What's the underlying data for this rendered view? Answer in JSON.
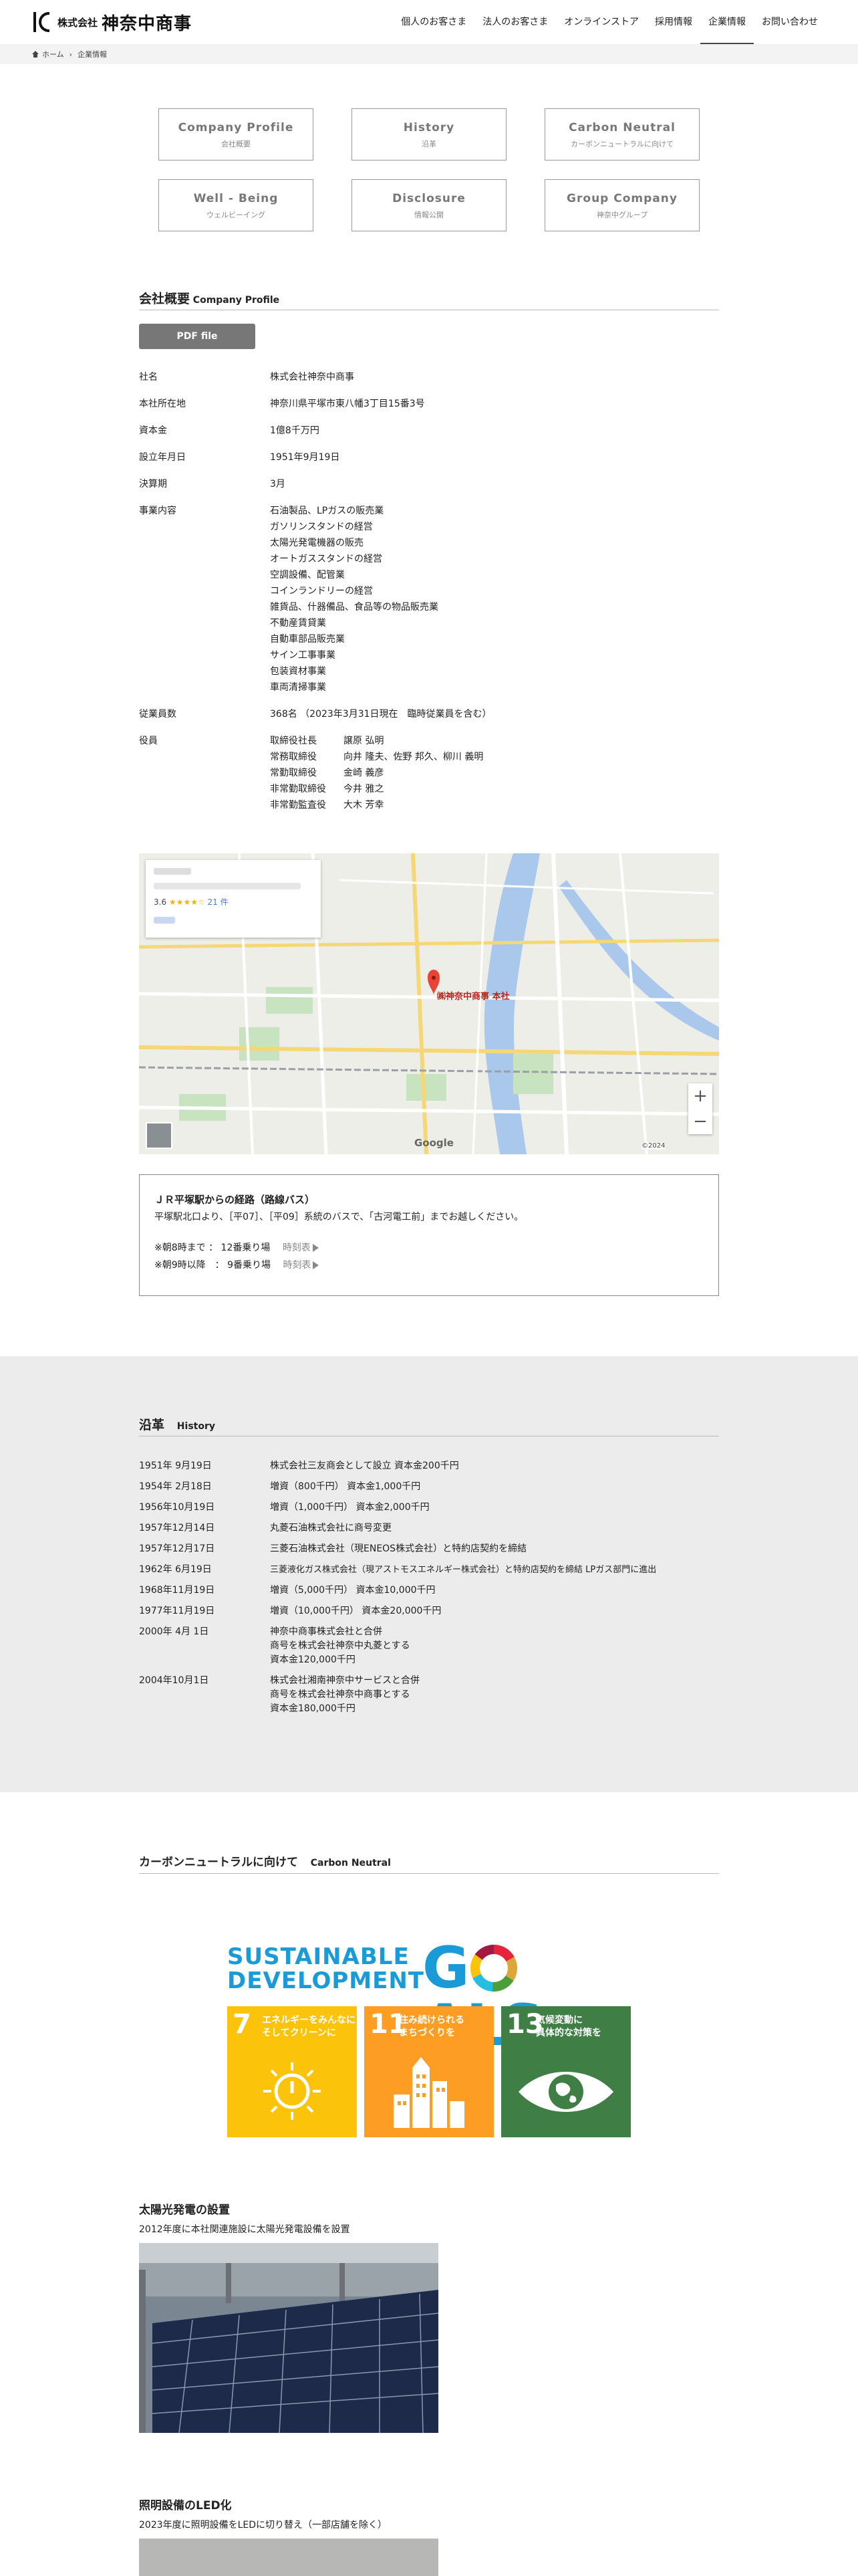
{
  "header": {
    "logo_small": "株式会社",
    "logo_big": "神奈中商事",
    "nav": [
      "個人のお客さま",
      "法人のお客さま",
      "オンラインストア",
      "採用情報",
      "企業情報",
      "お問い合わせ"
    ],
    "active_index": 4
  },
  "breadcrumb": {
    "home": "ホーム",
    "sep": "›",
    "current": "企業情報"
  },
  "boxes": [
    {
      "en": "Company Profile",
      "jp": "会社概要"
    },
    {
      "en": "History",
      "jp": "沿革"
    },
    {
      "en": "Carbon Neutral",
      "jp": "カーボンニュートラルに向けて"
    },
    {
      "en": "Well - Being",
      "jp": "ウェルビーイング"
    },
    {
      "en": "Disclosure",
      "jp": "情報公開"
    },
    {
      "en": "Group Company",
      "jp": "神奈中グループ"
    }
  ],
  "profile": {
    "heading_jp": "会社概要",
    "heading_en": "Company Profile",
    "pdf_label": "PDF file",
    "rows": {
      "name": {
        "label": "社名",
        "value": "株式会社神奈中商事"
      },
      "address": {
        "label": "本社所在地",
        "value": "神奈川県平塚市東八幡3丁目15番3号"
      },
      "capital": {
        "label": "資本金",
        "value": "1億8千万円"
      },
      "founded": {
        "label": "設立年月日",
        "value": "1951年9月19日"
      },
      "fiscal": {
        "label": "決算期",
        "value": "3月"
      },
      "business": {
        "label": "事業内容",
        "items": [
          "石油製品、LPガスの販売業",
          "ガソリンスタンドの経営",
          "太陽光発電機器の販売",
          "オートガススタンドの経営",
          "空調設備、配管業",
          "コインランドリーの経営",
          "雑貨品、什器備品、食品等の物品販売業",
          "不動産賃貸業",
          "自動車部品販売業",
          "サイン工事事業",
          "包装資材事業",
          "車両清掃事業"
        ]
      },
      "employees": {
        "label": "従業員数",
        "value": "368名 （2023年3月31日現在　臨時従業員を含む）"
      },
      "officers": {
        "label": "役員",
        "items": [
          {
            "title": "取締役社長",
            "name": "譲原 弘明"
          },
          {
            "title": "常務取締役",
            "name": "向井 隆夫、佐野 邦久、柳川 義明"
          },
          {
            "title": "常勤取締役",
            "name": "金崎 義彦"
          },
          {
            "title": "非常勤取締役",
            "name": "今井 雅之"
          },
          {
            "title": "非常勤監査役",
            "name": "大木 芳幸"
          }
        ]
      }
    }
  },
  "map": {
    "pin_label": "㈱神奈中商事 本社",
    "rating": "3.6",
    "stars": "★★★★☆",
    "reviews": "21 件",
    "zoom_in": "+",
    "zoom_out": "−",
    "copyright": "©2024",
    "google": "Google"
  },
  "access": {
    "title": "ＪＲ平塚駅からの経路（路線バス）",
    "desc": "平塚駅北口より、［平07］、［平09］系統のバスで、「古河電工前」までお越しください。",
    "lines": [
      {
        "text": "※朝8時まで ： 12番乗り場",
        "link": "時刻表"
      },
      {
        "text": "※朝9時以降　： 9番乗り場",
        "link": "時刻表"
      }
    ]
  },
  "history": {
    "heading_jp": "沿革",
    "heading_en": "History",
    "rows": [
      {
        "date": "1951年 9月19日",
        "lines": [
          "株式会社三友商会として設立 資本金200千円"
        ]
      },
      {
        "date": "1954年 2月18日",
        "lines": [
          "増資（800千円） 資本金1,000千円"
        ]
      },
      {
        "date": "1956年10月19日",
        "lines": [
          "増資（1,000千円） 資本金2,000千円"
        ]
      },
      {
        "date": "1957年12月14日",
        "lines": [
          "丸菱石油株式会社に商号変更"
        ]
      },
      {
        "date": "1957年12月17日",
        "lines": [
          "三菱石油株式会社（現ENEOS株式会社）と特約店契約を締結"
        ]
      },
      {
        "date": "1962年 6月19日",
        "lines": [
          "三菱液化ガス株式会社（現アストモスエネルギー株式会社）と特約店契約を締結 LPガス部門に進出"
        ]
      },
      {
        "date": "1968年11月19日",
        "lines": [
          "増資（5,000千円） 資本金10,000千円"
        ]
      },
      {
        "date": "1977年11月19日",
        "lines": [
          "増資（10,000千円） 資本金20,000千円"
        ]
      },
      {
        "date": "2000年 4月 1日",
        "lines": [
          "神奈中商事株式会社と合併",
          "商号を株式会社神奈中丸菱とする",
          "資本金120,000千円"
        ]
      },
      {
        "date": "2004年10月1日",
        "lines": [
          "株式会社湘南神奈中サービスと合併",
          "商号を株式会社神奈中商事とする",
          "資本金180,000千円"
        ]
      }
    ]
  },
  "carbon": {
    "heading_jp": "カーボンニュートラルに向けて",
    "heading_en": "Carbon Neutral",
    "sdg_title1": "SUSTAINABLE",
    "sdg_title2": "DEVELOPMENT",
    "sdg_goals_g": "G",
    "sdg_goals_rest": "ALS",
    "tiles": [
      {
        "num": "7",
        "text": "エネルギーをみんなに\nそしてクリーンに",
        "color": "#fcc30b"
      },
      {
        "num": "11",
        "text": "住み続けられる\nまちづくりを",
        "color": "#fd9d24"
      },
      {
        "num": "13",
        "text": "気候変動に\n具体的な対策を",
        "color": "#3f7e44"
      }
    ],
    "solar": {
      "title": "太陽光発電の設置",
      "desc": "2012年度に本社関連施設に太陽光発電設備を設置"
    },
    "led": {
      "title": "照明設備のLED化",
      "desc": "2023年度に照明設備をLEDに切り替え（一部店舗を除く）"
    }
  }
}
